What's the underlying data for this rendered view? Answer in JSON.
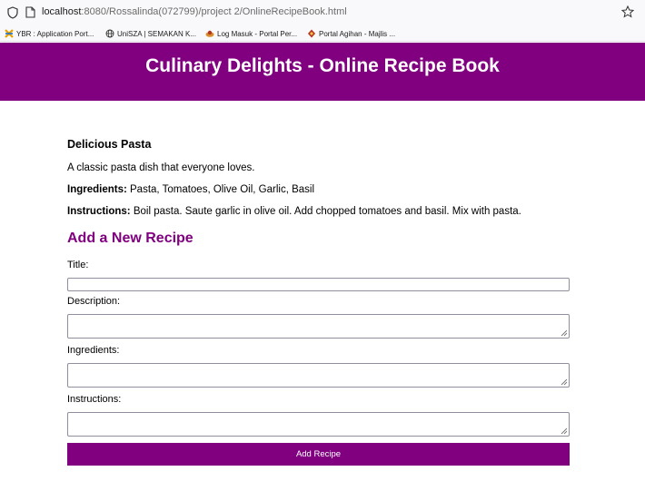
{
  "browser": {
    "url_host": "localhost",
    "url_path": ":8080/Rossalinda(072799)/project 2/OnlineRecipeBook.html",
    "bookmarks": [
      {
        "label": "YBR : Application Port...",
        "icon": "ybr-icon"
      },
      {
        "label": "UniSZA | SEMAKAN K...",
        "icon": "globe-icon"
      },
      {
        "label": "Log Masuk - Portal Per...",
        "icon": "portal-icon"
      },
      {
        "label": "Portal Agihan - Majlis ...",
        "icon": "majlis-icon"
      }
    ]
  },
  "header": {
    "title": "Culinary Delights - Online Recipe Book",
    "color": "#800080"
  },
  "recipe": {
    "name": "Delicious Pasta",
    "description": "A classic pasta dish that everyone loves.",
    "ingredients_label": "Ingredients:",
    "ingredients": " Pasta, Tomatoes, Olive Oil, Garlic, Basil",
    "instructions_label": "Instructions:",
    "instructions": " Boil pasta. Saute garlic in olive oil. Add chopped tomatoes and basil. Mix with pasta."
  },
  "form": {
    "heading": "Add a New Recipe",
    "title_label": "Title:",
    "title_value": "",
    "description_label": "Description:",
    "description_value": "",
    "ingredients_label": "Ingredients:",
    "ingredients_value": "",
    "instructions_label": "Instructions:",
    "instructions_value": "",
    "submit_label": "Add Recipe"
  }
}
